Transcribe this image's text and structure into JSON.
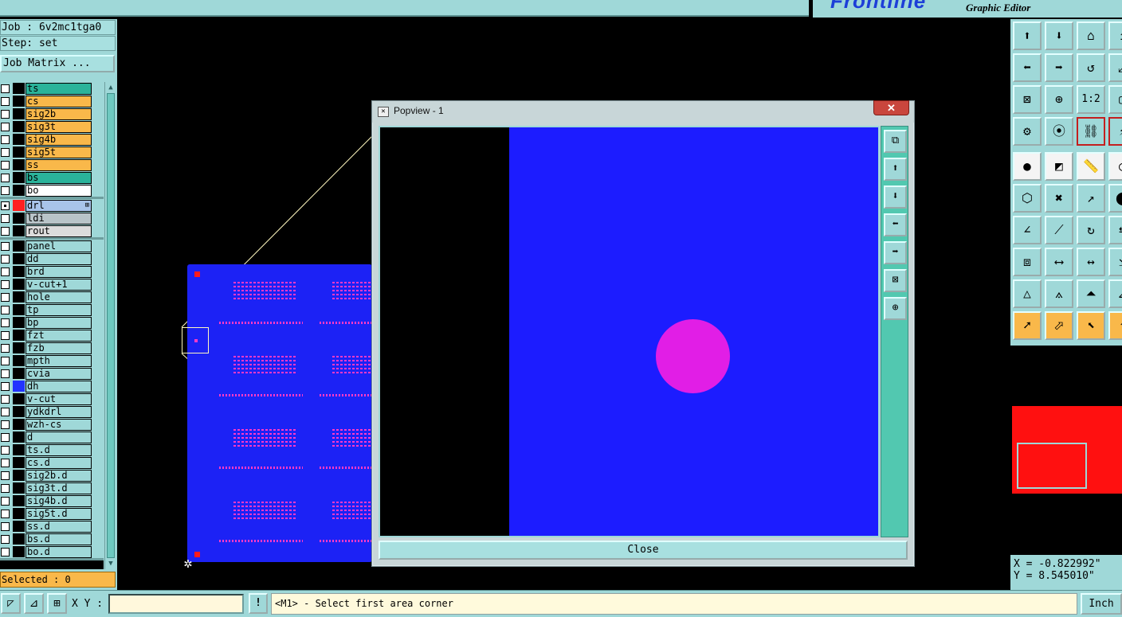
{
  "app": {
    "brand": "Frontline",
    "subtitle": "Graphic Editor"
  },
  "left_panel": {
    "job_line": "Job : 6v2mc1tga0",
    "step_line": "Step: set",
    "job_matrix_label": "Job Matrix ...",
    "selected_label": "Selected : 0"
  },
  "layer_groups": [
    [
      {
        "name": "ts",
        "color": "#2ab39a"
      },
      {
        "name": "cs",
        "color": "#f9b84a"
      },
      {
        "name": "sig2b",
        "color": "#f9b84a"
      },
      {
        "name": "sig3t",
        "color": "#f9b84a"
      },
      {
        "name": "sig4b",
        "color": "#f9b84a"
      },
      {
        "name": "sig5t",
        "color": "#f9b84a"
      },
      {
        "name": "ss",
        "color": "#f9b84a"
      },
      {
        "name": "bs",
        "color": "#2ab39a"
      },
      {
        "name": "bo",
        "color": "#ffffff"
      }
    ],
    [
      {
        "name": "drl",
        "color": "#a8c4ea",
        "swatch": "#ff2020",
        "checked": true,
        "more": true
      },
      {
        "name": "ldi",
        "color": "#b8c4c8"
      },
      {
        "name": "rout",
        "color": "#dcdcdc"
      }
    ],
    [
      {
        "name": "panel",
        "color": "#9fd8d8"
      },
      {
        "name": "dd",
        "color": "#9fd8d8"
      },
      {
        "name": "brd",
        "color": "#9fd8d8"
      },
      {
        "name": "v-cut+1",
        "color": "#9fd8d8"
      },
      {
        "name": "hole",
        "color": "#9fd8d8"
      },
      {
        "name": "tp",
        "color": "#9fd8d8"
      },
      {
        "name": "bp",
        "color": "#9fd8d8"
      },
      {
        "name": "fzt",
        "color": "#9fd8d8"
      },
      {
        "name": "fzb",
        "color": "#9fd8d8"
      },
      {
        "name": "mpth",
        "color": "#9fd8d8"
      },
      {
        "name": "cvia",
        "color": "#9fd8d8"
      },
      {
        "name": "dh",
        "color": "#9fd8d8",
        "swatch": "#2233ff"
      },
      {
        "name": "v-cut",
        "color": "#9fd8d8"
      },
      {
        "name": "ydkdrl",
        "color": "#9fd8d8"
      },
      {
        "name": "wzh-cs",
        "color": "#9fd8d8"
      },
      {
        "name": "d",
        "color": "#9fd8d8"
      },
      {
        "name": "ts.d",
        "color": "#9fd8d8"
      },
      {
        "name": "cs.d",
        "color": "#9fd8d8"
      },
      {
        "name": "sig2b.d",
        "color": "#9fd8d8"
      },
      {
        "name": "sig3t.d",
        "color": "#9fd8d8"
      },
      {
        "name": "sig4b.d",
        "color": "#9fd8d8"
      },
      {
        "name": "sig5t.d",
        "color": "#9fd8d8"
      },
      {
        "name": "ss.d",
        "color": "#9fd8d8"
      },
      {
        "name": "bs.d",
        "color": "#9fd8d8"
      },
      {
        "name": "bo.d",
        "color": "#9fd8d8"
      }
    ]
  ],
  "popview": {
    "title": "Popview - 1",
    "close_x": "✕",
    "close_button": "Close",
    "tools": [
      "zoom-fit-icon",
      "pan-up-icon",
      "pan-down-icon",
      "pan-left-icon",
      "pan-right-icon",
      "zoom-out-icon",
      "zoom-in-icon"
    ]
  },
  "toolbox": {
    "buttons": [
      [
        "pan-up-icon",
        "pan-down-icon",
        "home-icon",
        "pan-extra-icon"
      ],
      [
        "pan-left-icon",
        "pan-right-icon",
        "zoom-back-icon",
        "zoom-extra-icon"
      ],
      [
        "zoom-out-icon",
        "zoom-in-icon",
        "one-to-two-icon",
        "zoom-window-icon"
      ],
      [
        "snap-icon",
        "measure-point-icon",
        "select-net-icon",
        "net-extra-icon"
      ],
      [
        "pad-icon",
        "resize-icon",
        "ruler-icon",
        "round-icon"
      ],
      [
        "connect-icon",
        "delete-icon",
        "move-icon",
        "move-extra-icon"
      ],
      [
        "line-icon",
        "slant-icon",
        "rotate-icon",
        "flip-icon"
      ],
      [
        "crop-icon",
        "stretch-icon",
        "span-icon",
        "span-extra-icon"
      ],
      [
        "arc-icon",
        "triangle-icon",
        "shape-up-icon",
        "shape-extra-icon"
      ],
      [
        "pointer-icon",
        "select-icon",
        "select-box-icon",
        "select-extra-icon"
      ]
    ],
    "label_one_two": "1:2"
  },
  "coords": {
    "x_line": "X = -0.822992\"",
    "y_line": "Y = 8.545010\""
  },
  "bottom": {
    "xy_label": "X Y :",
    "xy_value": "",
    "prompt": "<M1> - Select first area corner",
    "unit": "Inch",
    "warn": "!"
  },
  "colors": {
    "accent": "#9fd8d8",
    "board": "#1c22f5",
    "pad": "#ff1a1a",
    "trace": "#ff39c9",
    "circle": "#e11ee6"
  }
}
